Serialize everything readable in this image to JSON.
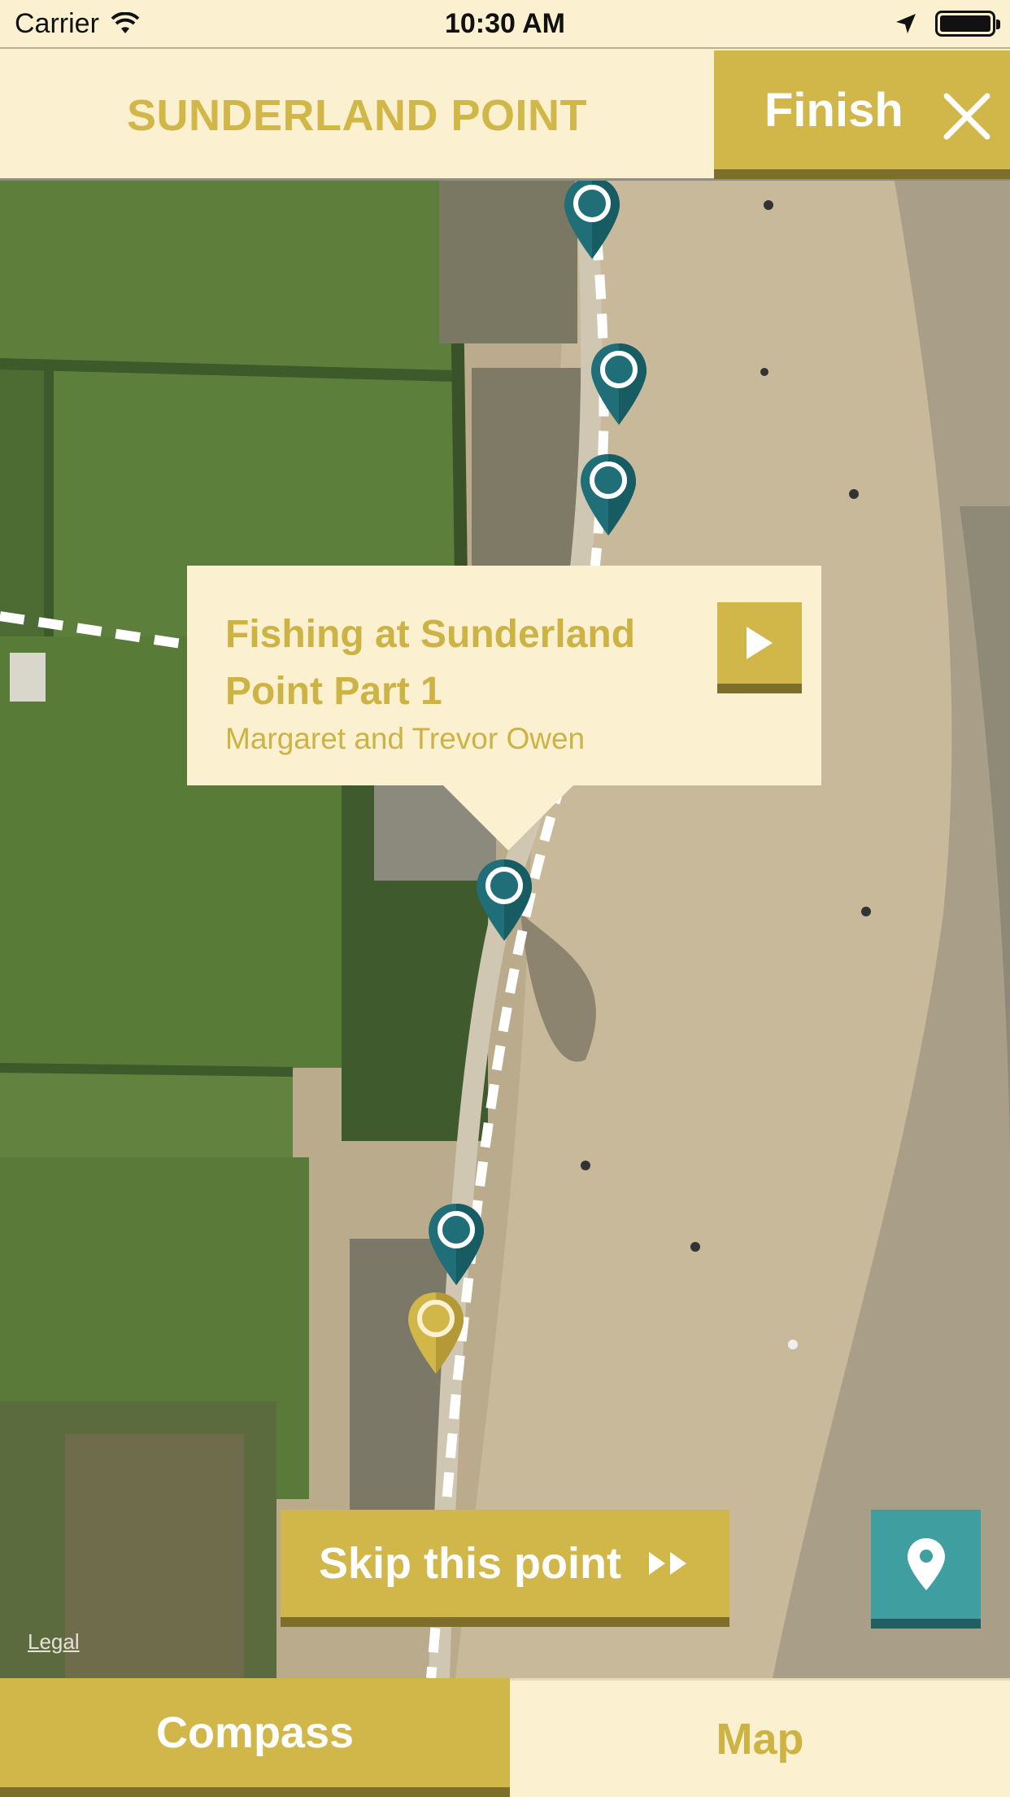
{
  "status_bar": {
    "carrier": "Carrier",
    "time": "10:30 AM",
    "wifi_icon": "wifi-icon",
    "location_icon": "location-arrow-icon",
    "battery_level": 1.0
  },
  "header": {
    "title": "SUNDERLAND POINT",
    "finish_label": "Finish",
    "close_icon": "close-icon"
  },
  "callout": {
    "title": "Fishing at Sunderland Point Part 1",
    "subtitle": "Margaret and Trevor Owen",
    "play_icon": "play-icon"
  },
  "map": {
    "legal_label": "Legal",
    "pins": [
      {
        "kind": "waypoint",
        "color": "#1f6e78"
      },
      {
        "kind": "waypoint",
        "color": "#1f6e78"
      },
      {
        "kind": "waypoint",
        "color": "#1f6e78"
      },
      {
        "kind": "waypoint",
        "color": "#1f6e78"
      },
      {
        "kind": "waypoint",
        "color": "#1f6e78"
      },
      {
        "kind": "current",
        "color": "#d1b64a"
      }
    ]
  },
  "actions": {
    "skip_label": "Skip this point",
    "skip_icon": "fast-forward-icon",
    "locate_icon": "map-pin-icon"
  },
  "tabs": [
    {
      "label": "Compass",
      "active": true
    },
    {
      "label": "Map",
      "active": false
    }
  ],
  "colors": {
    "accent_gold": "#d1b64a",
    "accent_teal": "#3e9ea0",
    "pin_teal": "#1f6e78",
    "cream": "#fbf1d1"
  }
}
